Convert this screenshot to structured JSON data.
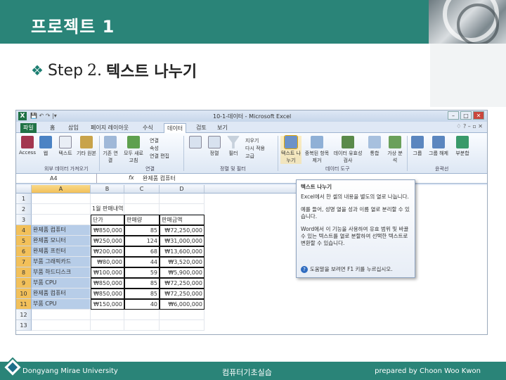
{
  "slide": {
    "title": "프로젝트 1",
    "step_label": "Step",
    "step_num": "2.",
    "step_text": "텍스트 나누기",
    "footer_left": "Dongyang Mirae University",
    "footer_center": "컴퓨터기초실습",
    "footer_right": "prepared by Choon Woo Kwon"
  },
  "excel": {
    "window_title": "10-1-데이터 - Microsoft Excel",
    "tabs": [
      "파일",
      "홈",
      "삽입",
      "페이지 레이아웃",
      "수식",
      "데이터",
      "검토",
      "보기"
    ],
    "active_tab": "데이터",
    "ribbon_groups": [
      "외부 데이터 가져오기",
      "연결",
      "정렬 및 필터",
      "데이터 도구",
      "윤곽선"
    ],
    "ribbon_buttons": [
      {
        "label": "Access",
        "icon": "access-icon"
      },
      {
        "label": "웹",
        "icon": "web-icon"
      },
      {
        "label": "텍스트",
        "icon": "text-import-icon"
      },
      {
        "label": "기타 원본",
        "icon": "other-sources-icon"
      },
      {
        "label": "기존 연결",
        "icon": "existing-connections-icon"
      },
      {
        "label": "모두 새로 고침",
        "icon": "refresh-all-icon"
      },
      {
        "label": "정렬",
        "icon": "sort-icon"
      },
      {
        "label": "필터",
        "icon": "filter-icon"
      },
      {
        "label": "텍스트 나누기",
        "icon": "text-to-columns-icon"
      },
      {
        "label": "중복된 항목 제거",
        "icon": "remove-duplicates-icon"
      },
      {
        "label": "데이터 유효성 검사",
        "icon": "data-validation-icon"
      },
      {
        "label": "통합",
        "icon": "consolidate-icon"
      },
      {
        "label": "가상 분석",
        "icon": "what-if-icon"
      },
      {
        "label": "그룹",
        "icon": "group-icon"
      },
      {
        "label": "그룹 해제",
        "icon": "ungroup-icon"
      },
      {
        "label": "부분합",
        "icon": "subtotal-icon"
      }
    ],
    "ribbon_small": [
      "연결",
      "속성",
      "연결 편집",
      "지우기",
      "다시 적용",
      "고급"
    ],
    "name_box": "A4",
    "formula_value": "완제품 컴퓨터",
    "columns": [
      "A",
      "B",
      "C",
      "D"
    ],
    "rows": [
      {
        "n": "1",
        "a": "",
        "b": "",
        "c": "",
        "d": ""
      },
      {
        "n": "2",
        "a": "",
        "b": "1월 판매내역",
        "c": "",
        "d": ""
      },
      {
        "n": "3",
        "a": "",
        "b": "단가",
        "c": "판매량",
        "d": "판매금액"
      },
      {
        "n": "4",
        "a": "완제품 컴퓨터",
        "b": "₩850,000",
        "c": "85",
        "d": "₩72,250,000"
      },
      {
        "n": "5",
        "a": "완제품 모니터",
        "b": "₩250,000",
        "c": "124",
        "d": "₩31,000,000"
      },
      {
        "n": "6",
        "a": "완제품 프린터",
        "b": "₩200,000",
        "c": "68",
        "d": "₩13,600,000"
      },
      {
        "n": "7",
        "a": "부품 그래픽카드",
        "b": "₩80,000",
        "c": "44",
        "d": "₩3,520,000"
      },
      {
        "n": "8",
        "a": "부품 하드디스크",
        "b": "₩100,000",
        "c": "59",
        "d": "₩5,900,000"
      },
      {
        "n": "9",
        "a": "부품 CPU",
        "b": "₩850,000",
        "c": "85",
        "d": "₩72,250,000"
      },
      {
        "n": "10",
        "a": "완제품 컴퓨터",
        "b": "₩850,000",
        "c": "85",
        "d": "₩72,250,000"
      },
      {
        "n": "11",
        "a": "부품 CPU",
        "b": "₩150,000",
        "c": "40",
        "d": "₩6,000,000"
      },
      {
        "n": "12",
        "a": "",
        "b": "",
        "c": "",
        "d": ""
      },
      {
        "n": "13",
        "a": "",
        "b": "",
        "c": "",
        "d": ""
      }
    ],
    "tooltip": {
      "title": "텍스트 나누기",
      "p1": "Excel에서 한 셀의 내용을 별도의 열로 나눕니다.",
      "p2": "예를 들어, 성명 열을 성과 이름 열로 분리할 수 있습니다.",
      "p3": "Word에서 이 기능을 사용하여 유효 범위 및 바꿀 수 있는 텍스트를 열로 분할하여 선택한 텍스트로 변환할 수 있습니다.",
      "help": "도움말을 보려면 F1 키를 누르십시오."
    }
  }
}
